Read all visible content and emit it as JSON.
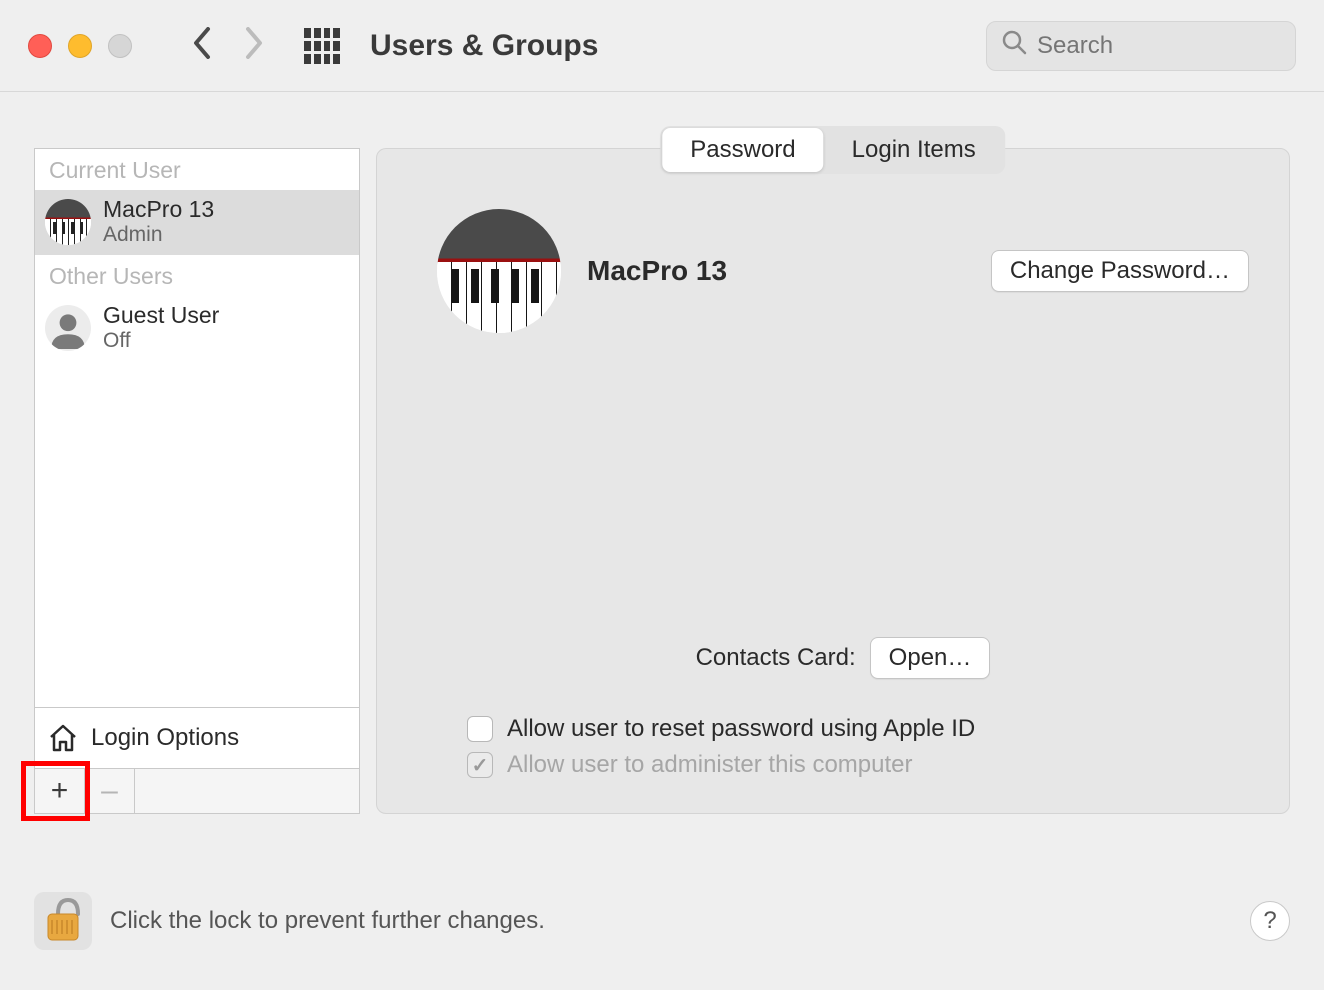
{
  "window": {
    "title": "Users & Groups",
    "search_placeholder": "Search"
  },
  "sidebar": {
    "current_user_header": "Current User",
    "other_users_header": "Other Users",
    "current_user": {
      "name": "MacPro 13",
      "role": "Admin"
    },
    "other_users": [
      {
        "name": "Guest User",
        "status": "Off"
      }
    ],
    "login_options_label": "Login Options",
    "add_symbol": "+",
    "remove_symbol": "–"
  },
  "tabs": {
    "password": "Password",
    "login_items": "Login Items",
    "active": "password"
  },
  "panel": {
    "user_display_name": "MacPro 13",
    "change_password_label": "Change Password…",
    "contacts_card_label": "Contacts Card:",
    "open_label": "Open…",
    "reset_password_label": "Allow user to reset password using Apple ID",
    "administer_label": "Allow user to administer this computer"
  },
  "footer": {
    "lock_text": "Click the lock to prevent further changes.",
    "help_symbol": "?"
  }
}
